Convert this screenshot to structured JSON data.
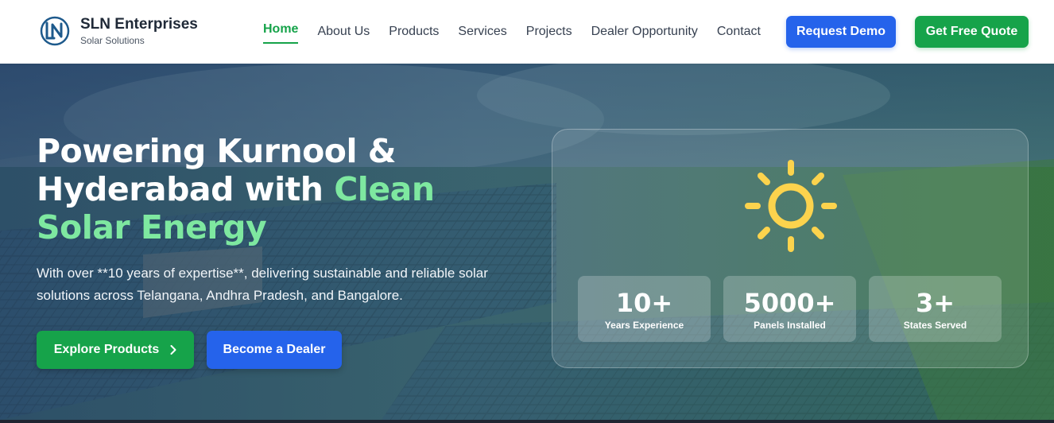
{
  "brand": {
    "name": "SLN Enterprises",
    "tagline": "Solar Solutions",
    "logo_letters": "LN"
  },
  "nav": {
    "items": [
      {
        "label": "Home",
        "active": true
      },
      {
        "label": "About Us",
        "active": false
      },
      {
        "label": "Products",
        "active": false
      },
      {
        "label": "Services",
        "active": false
      },
      {
        "label": "Projects",
        "active": false
      },
      {
        "label": "Dealer Opportunity",
        "active": false
      },
      {
        "label": "Contact",
        "active": false
      }
    ],
    "request_demo": "Request Demo",
    "free_quote": "Get Free Quote"
  },
  "hero": {
    "title_line1": "Powering Kurnool &",
    "title_line2_plain": "Hyderabad with ",
    "title_line2_accent": "Clean",
    "title_line3_accent": "Solar Energy",
    "subtitle": "With over **10 years of expertise**, delivering sustainable and reliable solar solutions across Telangana, Andhra Pradesh, and Bangalore.",
    "explore_button": "Explore Products",
    "dealer_button": "Become a Dealer"
  },
  "stats": [
    {
      "value": "10+",
      "label": "Years Experience"
    },
    {
      "value": "5000+",
      "label": "Panels Installed"
    },
    {
      "value": "3+",
      "label": "States Served"
    }
  ],
  "colors": {
    "primary_green": "#16a34a",
    "primary_blue": "#2563eb",
    "accent_green": "#7ee8a0",
    "sun_yellow": "#fcd34d"
  },
  "icons": {
    "logo": "sln-logo-icon",
    "sun": "sun-icon",
    "chevron": "chevron-right-icon"
  }
}
